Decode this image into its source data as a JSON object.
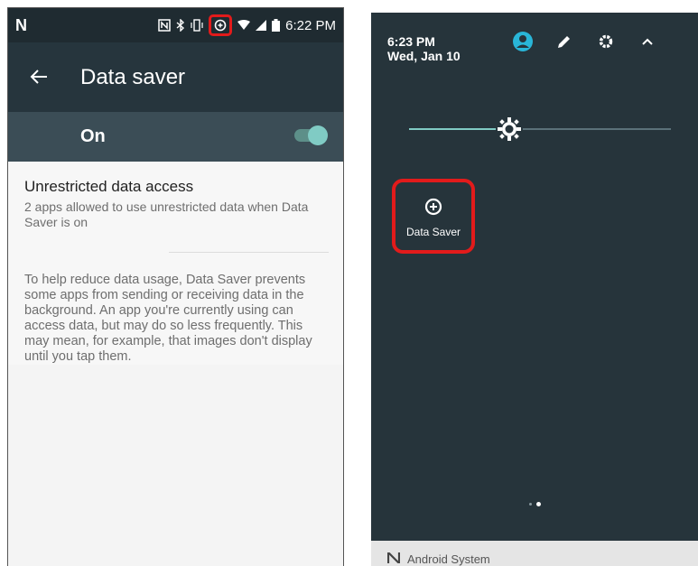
{
  "left": {
    "status": {
      "time": "6:22 PM",
      "carrier_glyph": "N"
    },
    "app_bar": {
      "title": "Data saver"
    },
    "toggle": {
      "label": "On",
      "state": "on"
    },
    "unrestricted": {
      "title": "Unrestricted data access",
      "subtitle": "2 apps allowed to use unrestricted data when Data Saver is on"
    },
    "description": "To help reduce data usage, Data Saver prevents some apps from sending or receiving data in the background. An app you're currently using can access data, but may do so less frequently. This may mean, for example, that images don't display until you tap them."
  },
  "right": {
    "time": "6:23 PM",
    "date": "Wed, Jan 10",
    "header_icons": [
      "account-icon",
      "edit-icon",
      "settings-icon",
      "collapse-icon"
    ],
    "tile": {
      "label": "Data Saver",
      "icon": "data-saver-icon"
    },
    "notification": {
      "app": "Android System"
    }
  },
  "colors": {
    "highlight": "#e21b1b",
    "accent": "#80cbc4",
    "app_bar": "#26353d",
    "panel": "#26343b"
  }
}
